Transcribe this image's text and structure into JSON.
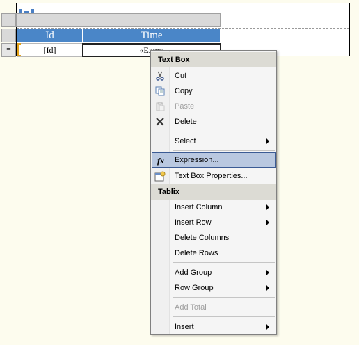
{
  "table": {
    "headers": [
      "Id",
      "Time"
    ],
    "row": [
      "[Id]",
      "«Expr»"
    ],
    "row_handle_icon": "≡"
  },
  "context_menu": {
    "section_textbox": "Text Box",
    "cut": "Cut",
    "copy": "Copy",
    "paste": "Paste",
    "delete": "Delete",
    "select": "Select",
    "expression": "Expression...",
    "textbox_properties": "Text Box Properties...",
    "section_tablix": "Tablix",
    "insert_column": "Insert Column",
    "insert_row": "Insert Row",
    "delete_columns": "Delete Columns",
    "delete_rows": "Delete Rows",
    "add_group": "Add Group",
    "row_group": "Row Group",
    "add_total": "Add Total",
    "insert": "Insert",
    "expression_icon_glyph": "fx"
  },
  "colors": {
    "header_fill": "#4a86c8",
    "highlight": "#b9c8e0",
    "canvas": "#fdfcee"
  }
}
